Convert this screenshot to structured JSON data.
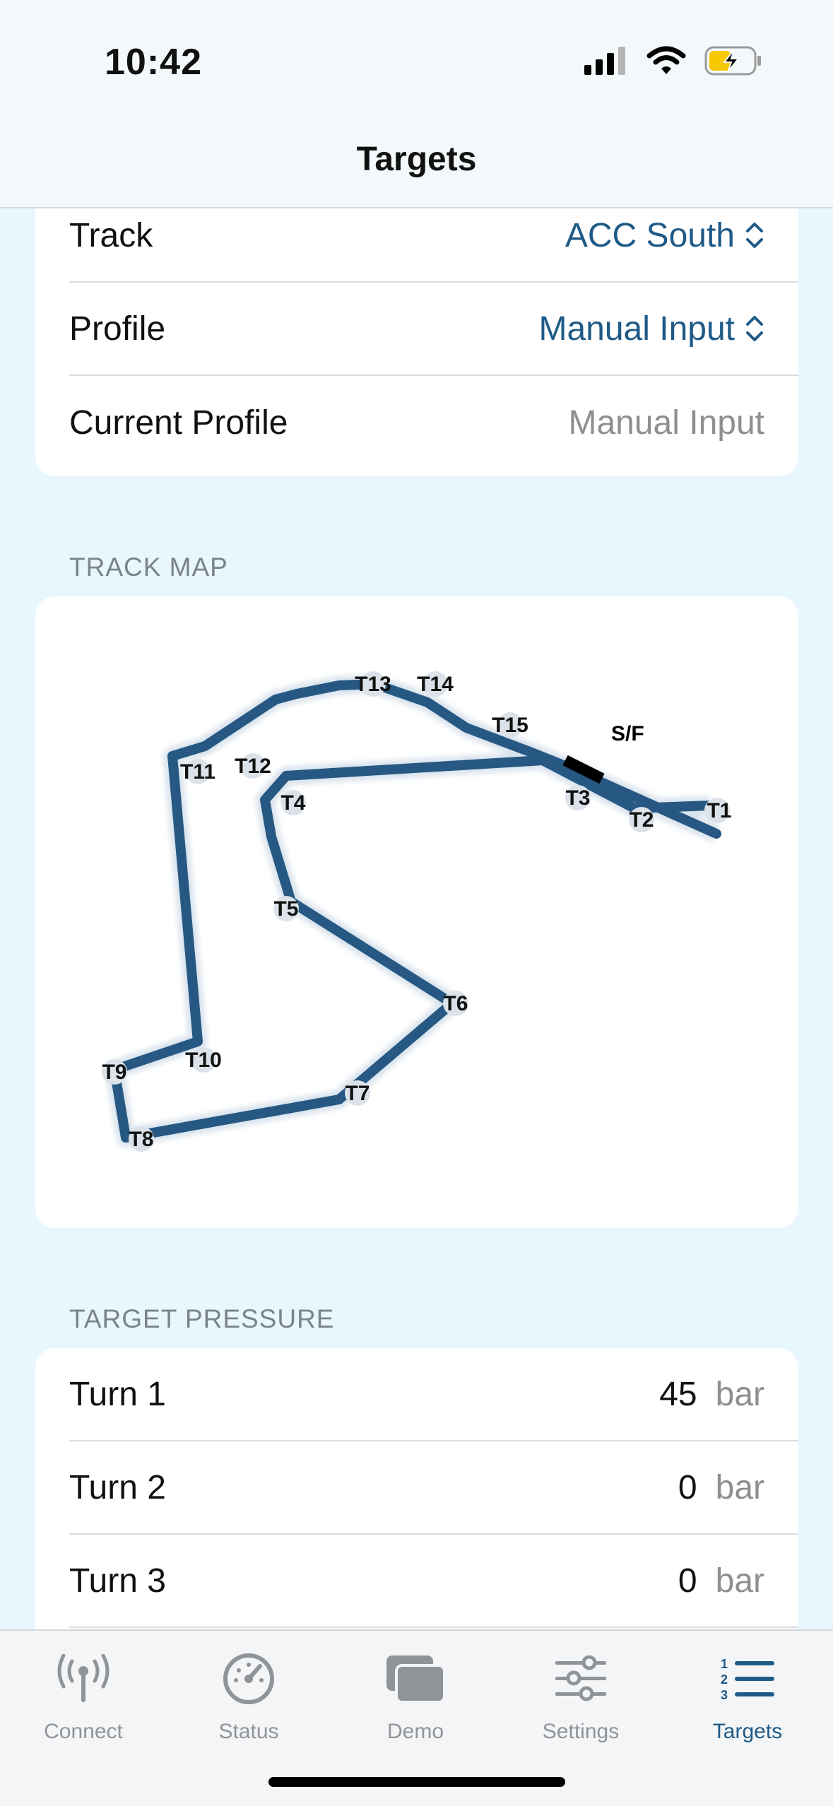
{
  "status_bar": {
    "time": "10:42"
  },
  "nav": {
    "title": "Targets"
  },
  "settings_card": {
    "rows": [
      {
        "label": "Track",
        "value": "ACC South"
      },
      {
        "label": "Profile",
        "value": "Manual Input"
      },
      {
        "label": "Current Profile",
        "value": "Manual Input"
      }
    ]
  },
  "track_map": {
    "section_label": "TRACK MAP",
    "start_finish_label": "S/F",
    "turns": [
      "T1",
      "T2",
      "T3",
      "T4",
      "T5",
      "T6",
      "T7",
      "T8",
      "T9",
      "T10",
      "T11",
      "T12",
      "T13",
      "T14",
      "T15"
    ],
    "track_color": "#265883"
  },
  "target_pressure": {
    "section_label": "TARGET PRESSURE",
    "rows": [
      {
        "label": "Turn 1",
        "value": "45",
        "unit": "bar"
      },
      {
        "label": "Turn 2",
        "value": "0",
        "unit": "bar"
      },
      {
        "label": "Turn 3",
        "value": "0",
        "unit": "bar"
      }
    ]
  },
  "tabs": [
    {
      "label": "Connect",
      "icon": "antenna-icon"
    },
    {
      "label": "Status",
      "icon": "gauge-icon"
    },
    {
      "label": "Demo",
      "icon": "windows-icon"
    },
    {
      "label": "Settings",
      "icon": "sliders-icon"
    },
    {
      "label": "Targets",
      "icon": "numbered-list-icon",
      "active": true
    }
  ],
  "colors": {
    "accent": "#1f5a86",
    "background": "#e8f7fe"
  }
}
